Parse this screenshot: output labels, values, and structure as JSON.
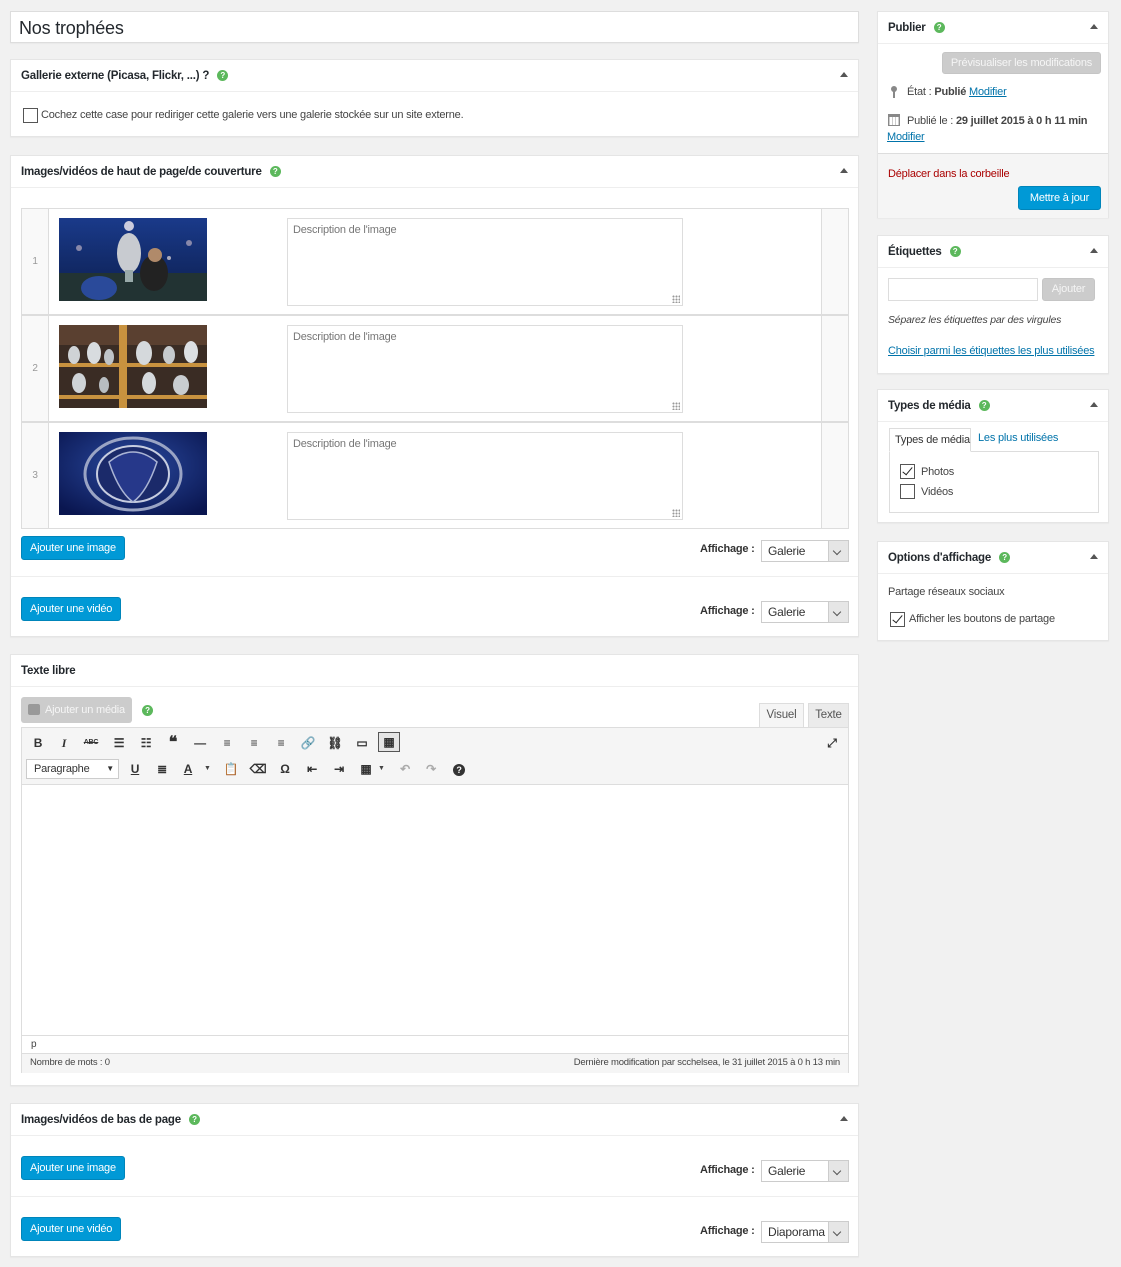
{
  "title": "Nos trophées",
  "external_gallery": {
    "header": "Gallerie externe (Picasa, Flickr, ...) ?",
    "help": "?",
    "checkbox_label": "Cochez cette case pour rediriger cette galerie vers une galerie stockée sur un site externe."
  },
  "cover_media": {
    "header": "Images/vidéos de haut de page/de couverture",
    "rows": [
      {
        "num": "1",
        "placeholder": "Description de l'image"
      },
      {
        "num": "2",
        "placeholder": "Description de l'image"
      },
      {
        "num": "3",
        "placeholder": "Description de l'image"
      }
    ],
    "add_image": "Ajouter une image",
    "add_video": "Ajouter une vidéo",
    "display_label": "Affichage :",
    "image_display": "Galerie",
    "video_display": "Galerie"
  },
  "free_text": {
    "header": "Texte libre",
    "add_media": "Ajouter un média",
    "tab_visual": "Visuel",
    "tab_text": "Texte",
    "format": "Paragraphe",
    "path": "p",
    "word_count": "Nombre de mots : 0",
    "last_modified": "Dernière modification par scchelsea, le 31 juillet 2015 à 0 h 13 min"
  },
  "bottom_media": {
    "header": "Images/vidéos de bas de page",
    "add_image": "Ajouter une image",
    "add_video": "Ajouter une vidéo",
    "display_label": "Affichage :",
    "image_display": "Galerie",
    "video_display": "Diaporama"
  },
  "publish": {
    "header": "Publier",
    "preview": "Prévisualiser les modifications",
    "state_label": "État :",
    "state_value": "Publié",
    "modify": "Modifier",
    "published_label": "Publié le :",
    "published_value": "29 juillet 2015 à 0 h 11 min",
    "modify2": "Modifier",
    "trash": "Déplacer dans la corbeille",
    "update": "Mettre à jour"
  },
  "tags": {
    "header": "Étiquettes",
    "add": "Ajouter",
    "hint": "Séparez les étiquettes par des virgules",
    "choose": "Choisir parmi les étiquettes les plus utilisées"
  },
  "media_types": {
    "header": "Types de média",
    "tab_all": "Types de média",
    "tab_popular": "Les plus utilisées",
    "items": [
      {
        "label": "Photos",
        "checked": true
      },
      {
        "label": "Vidéos",
        "checked": false
      }
    ]
  },
  "display_options": {
    "header": "Options d'affichage",
    "section": "Partage réseaux sociaux",
    "share_label": "Afficher les boutons de partage",
    "share_checked": true
  },
  "colors": {
    "accent": "#0099d6",
    "help": "#5cb85c",
    "trash": "#a00"
  }
}
